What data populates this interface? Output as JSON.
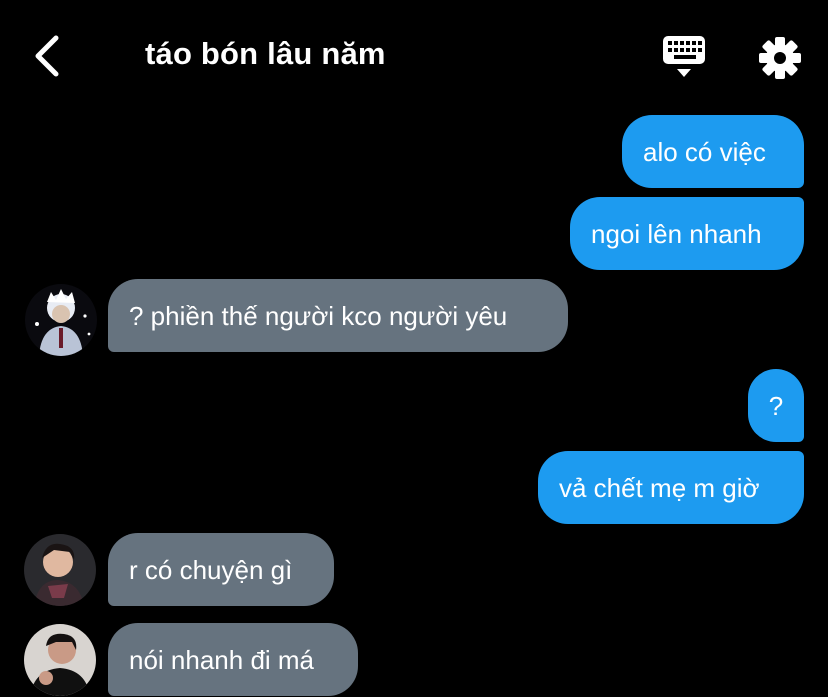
{
  "header": {
    "title": "táo bón lâu năm",
    "icons": {
      "back": "chevron-left-icon",
      "keyboard": "keyboard-icon",
      "settings": "gear-icon"
    }
  },
  "colors": {
    "background": "#000000",
    "outgoing_bubble": "#1d9bf0",
    "incoming_bubble": "#66737f",
    "text": "#ffffff"
  },
  "messages": [
    {
      "direction": "outgoing",
      "text": "alo có việc"
    },
    {
      "direction": "outgoing",
      "text": "ngoi lên nhanh"
    },
    {
      "direction": "incoming",
      "text": "? phiền thế người kco người yêu",
      "avatar": "avatar-1"
    },
    {
      "direction": "outgoing",
      "text": "?"
    },
    {
      "direction": "outgoing",
      "text": "vả chết mẹ m giờ"
    },
    {
      "direction": "incoming",
      "text": "r có chuyện gì",
      "avatar": "avatar-2"
    },
    {
      "direction": "incoming",
      "text": "nói nhanh đi má",
      "avatar": "avatar-3"
    }
  ]
}
